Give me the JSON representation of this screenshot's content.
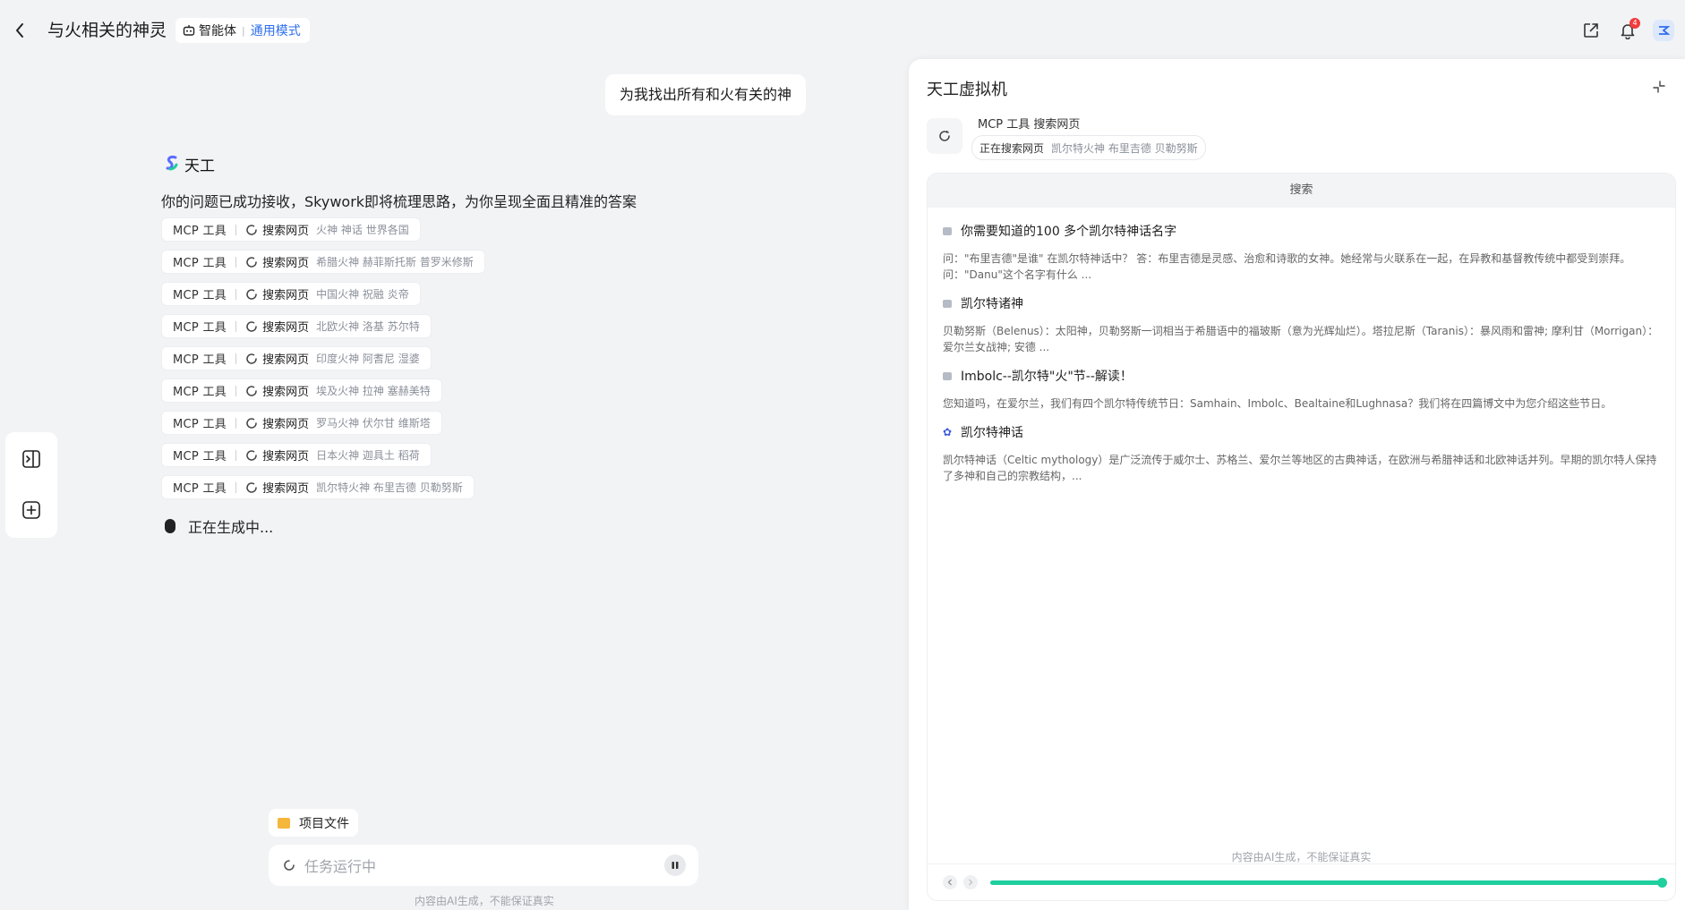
{
  "header": {
    "title": "与火相关的神灵",
    "agent_label": "智能体",
    "mode_label": "通用模式",
    "notification_count": "4"
  },
  "chat": {
    "user_message": "为我找出所有和火有关的神",
    "assistant_name": "天工",
    "received_text": "你的问题已成功接收，Skywork即将梳理思路，为你呈现全面且精准的答案",
    "tool_calls": [
      {
        "tool": "MCP 工具",
        "action": "搜索网页",
        "query": "火神 神话 世界各国"
      },
      {
        "tool": "MCP 工具",
        "action": "搜索网页",
        "query": "希腊火神 赫菲斯托斯 普罗米修斯"
      },
      {
        "tool": "MCP 工具",
        "action": "搜索网页",
        "query": "中国火神 祝融 炎帝"
      },
      {
        "tool": "MCP 工具",
        "action": "搜索网页",
        "query": "北欧火神 洛基 苏尔特"
      },
      {
        "tool": "MCP 工具",
        "action": "搜索网页",
        "query": "印度火神 阿耆尼 湿婆"
      },
      {
        "tool": "MCP 工具",
        "action": "搜索网页",
        "query": "埃及火神 拉神 塞赫美特"
      },
      {
        "tool": "MCP 工具",
        "action": "搜索网页",
        "query": "罗马火神 伏尔甘 维斯塔"
      },
      {
        "tool": "MCP 工具",
        "action": "搜索网页",
        "query": "日本火神 迦具土 稻荷"
      },
      {
        "tool": "MCP 工具",
        "action": "搜索网页",
        "query": "凯尔特火神 布里吉德 贝勒努斯"
      }
    ],
    "generating_text": "正在生成中..."
  },
  "composer": {
    "project_files_label": "项目文件",
    "placeholder": "任务运行中",
    "disclaimer": "内容由AI生成，不能保证真实"
  },
  "vm_panel": {
    "title": "天工虚拟机",
    "tool_label": "MCP 工具 搜索网页",
    "status": "正在搜索网页",
    "status_query": "凯尔特火神 布里吉德 贝勒努斯",
    "browser_tab": "搜索",
    "results": [
      {
        "title": "你需要知道的100 多个凯尔特神话名字",
        "snippet": "问：\"布里吉德\"是谁\" 在凯尔特神话中？ 答：布里吉德是灵感、治愈和诗歌的女神。她经常与火联系在一起，在异教和基督教传统中都受到崇拜。 问：\"Danu\"这个名字有什么 ..."
      },
      {
        "title": "凯尔特诸神",
        "snippet": "贝勒努斯（Belenus）：太阳神，贝勒努斯一词相当于希腊语中的福玻斯（意为光辉灿烂）。塔拉尼斯（Taranis）：暴风雨和雷神; 摩利甘（Morrigan）：爱尔兰女战神; 安德 ..."
      },
      {
        "title": "Imbolc--凯尔特\"火\"节--解读！",
        "snippet": "您知道吗，在爱尔兰，我们有四个凯尔特传统节日：Samhain、Imbolc、Bealtaine和Lughnasa？我们将在四篇博文中为您介绍这些节日。"
      },
      {
        "title": "凯尔特神话",
        "snippet": "凯尔特神话（Celtic mythology）是广泛流传于威尔士、苏格兰、爱尔兰等地区的古典神话，在欧洲与希腊神话和北欧神话并列。早期的凯尔特人保持了多神和自己的宗教结构，..."
      }
    ],
    "disclaimer": "内容由AI生成，不能保证真实",
    "progress": 1.0
  },
  "colors": {
    "accent": "#2f6fed",
    "progress": "#1fcf9e",
    "badge": "#f23c3c"
  }
}
